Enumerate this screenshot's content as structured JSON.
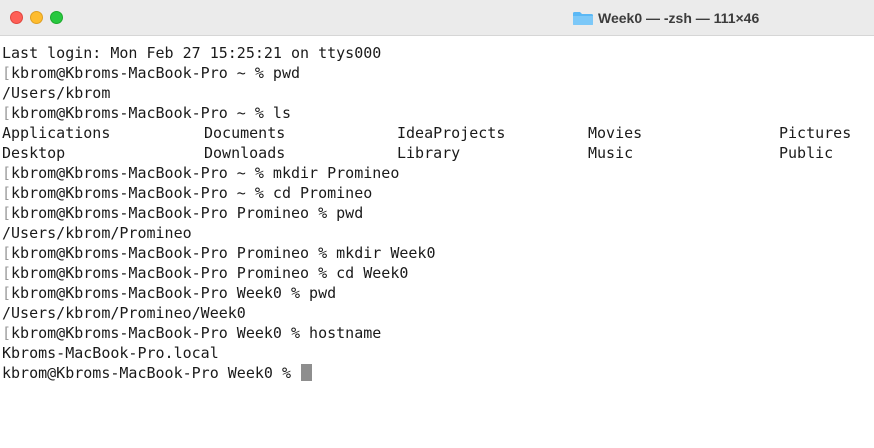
{
  "window": {
    "title": "Week0 — -zsh — 111×46"
  },
  "terminal": {
    "last_login": "Last login: Mon Feb 27 15:25:21 on ttys000",
    "lines": [
      "kbrom@Kbroms-MacBook-Pro ~ % pwd",
      "/Users/kbrom",
      "kbrom@Kbroms-MacBook-Pro ~ % ls",
      "kbrom@Kbroms-MacBook-Pro ~ % mkdir Promineo",
      "kbrom@Kbroms-MacBook-Pro ~ % cd Promineo",
      "kbrom@Kbroms-MacBook-Pro Promineo % pwd",
      "/Users/kbrom/Promineo",
      "kbrom@Kbroms-MacBook-Pro Promineo % mkdir Week0",
      "kbrom@Kbroms-MacBook-Pro Promineo % cd Week0",
      "kbrom@Kbroms-MacBook-Pro Week0 % pwd",
      "/Users/kbrom/Promineo/Week0",
      "kbrom@Kbroms-MacBook-Pro Week0 % hostname",
      "Kbroms-MacBook-Pro.local",
      "kbrom@Kbroms-MacBook-Pro Week0 % "
    ],
    "ls_output": {
      "row1": [
        "Applications",
        "Documents",
        "IdeaProjects",
        "Movies",
        "Pictures"
      ],
      "row2": [
        "Desktop",
        "Downloads",
        "Library",
        "Music",
        "Public"
      ]
    }
  },
  "colors": {
    "titlebar": "#ebebeb",
    "close": "#fe5f57",
    "minimize": "#febc2e",
    "maximize": "#28c840",
    "folder": "#5ab8f5",
    "text": "#1a1a1a",
    "cursor": "#8e8e8e"
  },
  "icons": {
    "folder": "folder-icon"
  }
}
